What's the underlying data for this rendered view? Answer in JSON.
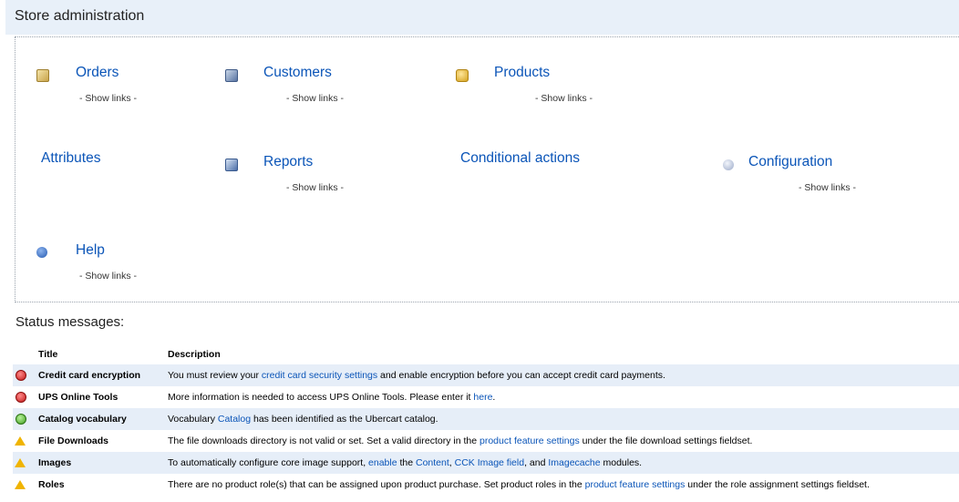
{
  "header": {
    "title": "Store administration"
  },
  "blocks": {
    "orders": {
      "title": "Orders",
      "show_links": "- Show links -"
    },
    "customers": {
      "title": "Customers",
      "show_links": "- Show links -"
    },
    "products": {
      "title": "Products",
      "show_links": "- Show links -"
    },
    "attributes": {
      "title": "Attributes"
    },
    "reports": {
      "title": "Reports",
      "show_links": "- Show links -"
    },
    "conditional_actions": {
      "title": "Conditional actions"
    },
    "configuration": {
      "title": "Configuration",
      "show_links": "- Show links -"
    },
    "help": {
      "title": "Help",
      "show_links": "- Show links -"
    }
  },
  "status": {
    "heading": "Status messages:",
    "columns": {
      "title": "Title",
      "description": "Description"
    },
    "rows": [
      {
        "severity": "error",
        "icon": "error-icon",
        "title": "Credit card encryption",
        "d1": "You must review your ",
        "l1": "credit card security settings",
        "d2": " and enable encryption before you can accept credit card payments."
      },
      {
        "severity": "error",
        "icon": "error-icon",
        "title": "UPS Online Tools",
        "d1": "More information is needed to access UPS Online Tools. Please enter it ",
        "l1": "here",
        "d2": "."
      },
      {
        "severity": "ok",
        "icon": "ok-icon",
        "title": "Catalog vocabulary",
        "d1": "Vocabulary ",
        "l1": "Catalog",
        "d2": " has been identified as the Ubercart catalog."
      },
      {
        "severity": "warning",
        "icon": "warning-icon",
        "title": "File Downloads",
        "d1": "The file downloads directory is not valid or set. Set a valid directory in the ",
        "l1": "product feature settings",
        "d2": " under the file download settings fieldset."
      },
      {
        "severity": "warning",
        "icon": "warning-icon",
        "title": "Images",
        "d1": "To automatically configure core image support, ",
        "l1": "enable",
        "d2": " the ",
        "l2": "Content",
        "d3": ", ",
        "l3": "CCK Image field",
        "d4": ", and ",
        "l4": "Imagecache",
        "d5": " modules."
      },
      {
        "severity": "warning",
        "icon": "warning-icon",
        "title": "Roles",
        "d1": "There are no product role(s) that can be assigned upon product purchase. Set product roles in the ",
        "l1": "product feature settings",
        "d2": " under the role assignment settings fieldset."
      }
    ]
  }
}
